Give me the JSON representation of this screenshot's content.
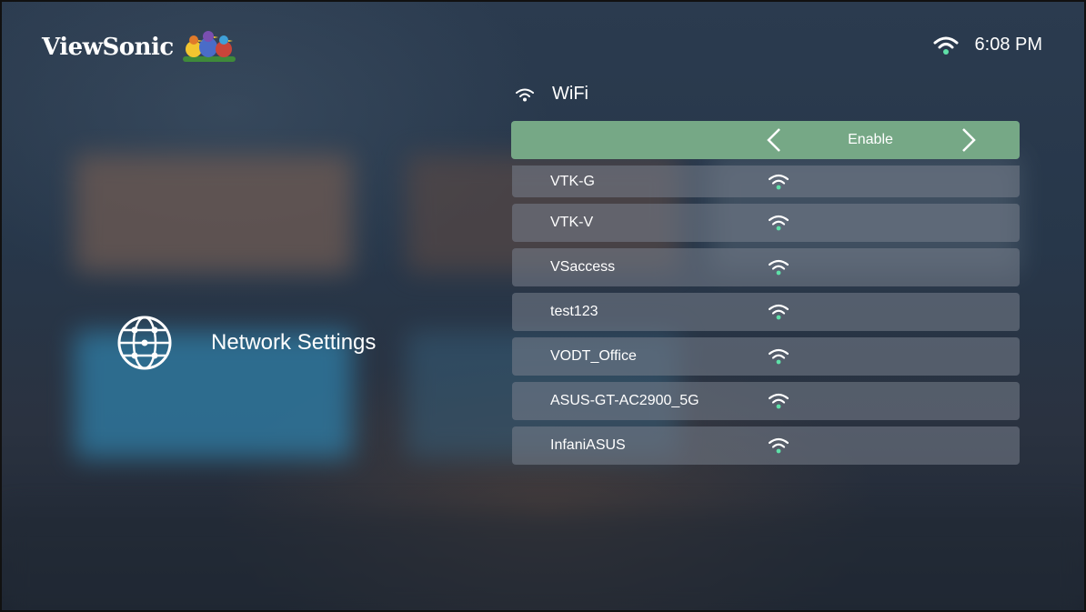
{
  "brand": {
    "name": "ViewSonic"
  },
  "status": {
    "time": "6:08 PM",
    "wifi_icon": "wifi-icon"
  },
  "section": {
    "title": "Network Settings",
    "icon": "globe-network-icon"
  },
  "wifi": {
    "label": "WiFi",
    "toggle": {
      "value": "Enable"
    }
  },
  "networks": [
    {
      "name": "VTK-G"
    },
    {
      "name": "VTK-V"
    },
    {
      "name": "VSaccess"
    },
    {
      "name": "test123"
    },
    {
      "name": "VODT_Office"
    },
    {
      "name": "ASUS-GT-AC2900_5G"
    },
    {
      "name": "InfaniASUS"
    }
  ],
  "colors": {
    "highlight": "#76a886",
    "signal": "#5fe0a8",
    "row_bg": "#7a828c"
  }
}
